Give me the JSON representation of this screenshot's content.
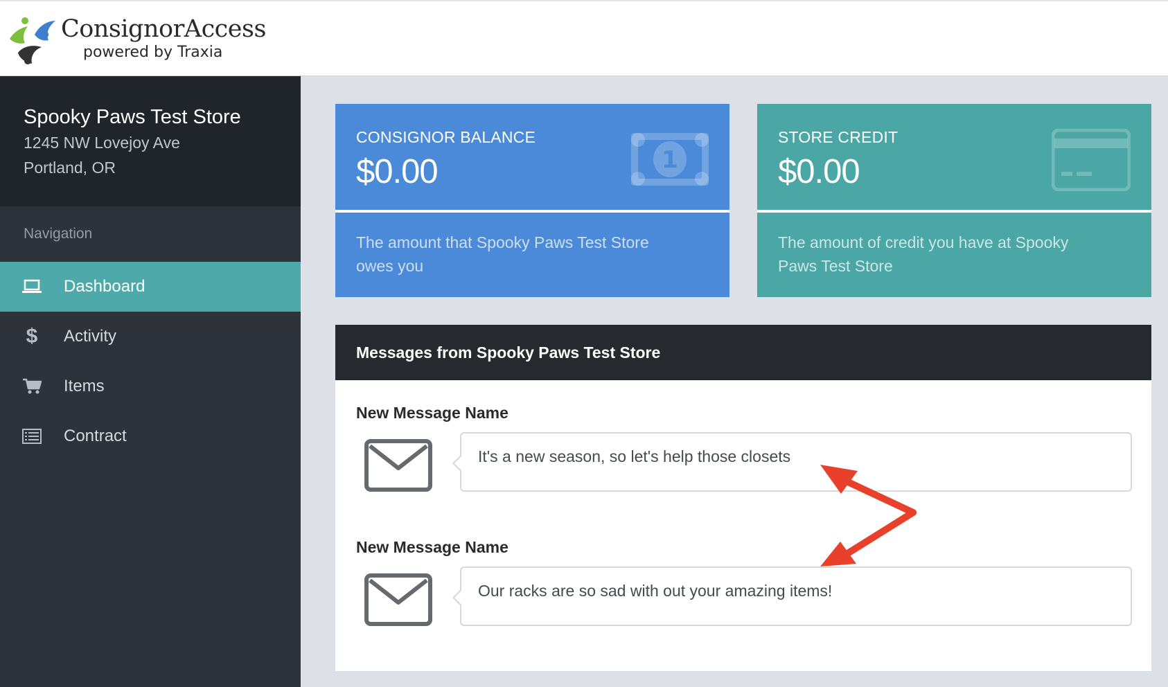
{
  "brand": {
    "name": "ConsignorAccess",
    "tagline": "powered by Traxia"
  },
  "store": {
    "name": "Spooky Paws Test Store",
    "address_line1": "1245 NW Lovejoy Ave",
    "address_line2": "Portland, OR"
  },
  "nav": {
    "heading": "Navigation",
    "items": [
      {
        "label": "Dashboard",
        "icon": "laptop-icon",
        "active": true
      },
      {
        "label": "Activity",
        "icon": "dollar-icon",
        "active": false
      },
      {
        "label": "Items",
        "icon": "cart-icon",
        "active": false
      },
      {
        "label": "Contract",
        "icon": "list-icon",
        "active": false
      }
    ]
  },
  "cards": {
    "consignor_balance": {
      "title": "CONSIGNOR BALANCE",
      "amount": "$0.00",
      "description": "The amount that Spooky Paws Test Store owes you",
      "icon": "money-bill-icon",
      "color": "#4a8ad9"
    },
    "store_credit": {
      "title": "STORE CREDIT",
      "amount": "$0.00",
      "description": "The amount of credit you have at Spooky Paws Test Store",
      "icon": "credit-card-icon",
      "color": "#4aa7a6"
    }
  },
  "messages": {
    "header": "Messages from Spooky Paws Test Store",
    "items": [
      {
        "title": "New Message Name",
        "body": "It's a new season, so let's help those closets",
        "icon": "envelope-icon"
      },
      {
        "title": "New Message Name",
        "body": "Our racks are so sad with out your amazing items!",
        "icon": "envelope-icon"
      }
    ]
  },
  "colors": {
    "sidebar": "#2e333b",
    "sidebar_header": "#20252c",
    "active_nav": "#4eaaaa",
    "panel_header": "#262a2f",
    "annotation_arrow": "#e8402a"
  }
}
